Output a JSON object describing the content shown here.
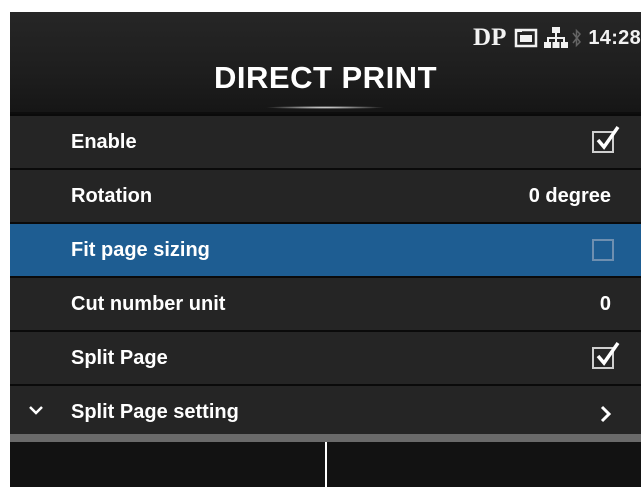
{
  "status": {
    "mode": "DP",
    "card_icon": "storage-card-icon",
    "network_icon": "network-icon",
    "bluetooth_icon": "bluetooth-icon",
    "time": "14:28"
  },
  "header": {
    "title": "DIRECT PRINT"
  },
  "menu": {
    "items": [
      {
        "label": "Enable",
        "control": "checkbox",
        "checked": true
      },
      {
        "label": "Rotation",
        "control": "value",
        "value": "0 degree"
      },
      {
        "label": "Fit page sizing",
        "control": "checkbox",
        "checked": false,
        "selected": true
      },
      {
        "label": "Cut number unit",
        "control": "value",
        "value": "0"
      },
      {
        "label": "Split Page",
        "control": "checkbox",
        "checked": true
      },
      {
        "label": "Split Page setting",
        "control": "submenu",
        "expand_icon": "chevron-down-icon",
        "arrow_icon": "chevron-right-icon"
      }
    ]
  },
  "colors": {
    "selected_row": "#1e5d92",
    "row_background": "#252525",
    "text": "#ffffff"
  }
}
